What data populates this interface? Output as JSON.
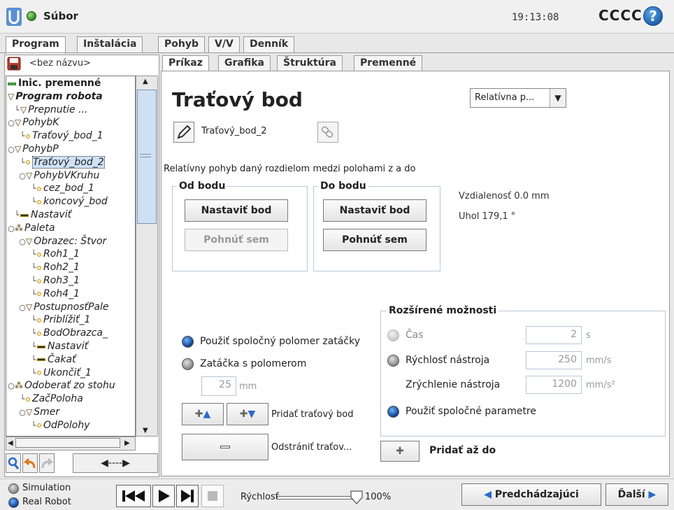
{
  "top": {
    "file_menu": "Súbor",
    "clock": "19:13:08",
    "robot_name": "CCCC",
    "help": "?"
  },
  "main_tabs": [
    "Program",
    "Inštalácia",
    "Pohyb",
    "V/V",
    "Denník"
  ],
  "program_name": "<bez názvu>",
  "tree": [
    {
      "label": "Inic. premenné",
      "type": "bar-green",
      "indent": 0,
      "bold": true,
      "italic": false
    },
    {
      "label": "Program robota",
      "type": "tri",
      "indent": 0,
      "bold": true
    },
    {
      "label": "Prepnutie ...",
      "type": "tri",
      "indent": 1
    },
    {
      "label": "PohybK",
      "type": "tri",
      "indent": 0,
      "expander": true
    },
    {
      "label": "Traťový_bod_1",
      "type": "dot",
      "indent": 2
    },
    {
      "label": "PohybP",
      "type": "tri",
      "indent": 0,
      "expander": true
    },
    {
      "label": "Traťový_bod_2",
      "type": "dot",
      "indent": 2,
      "selected": true
    },
    {
      "label": "PohybVKruhu",
      "type": "tri",
      "indent": 2,
      "expander": true
    },
    {
      "label": "cez_bod_1",
      "type": "dot",
      "indent": 4
    },
    {
      "label": "koncový_bod",
      "type": "dot",
      "indent": 4
    },
    {
      "label": "Nastaviť",
      "type": "bar",
      "indent": 1
    },
    {
      "label": "Paleta",
      "type": "pal",
      "indent": 0,
      "expander": true
    },
    {
      "label": "Obrazec: Štvor",
      "type": "tri",
      "indent": 2,
      "expander": true
    },
    {
      "label": "Roh1_1",
      "type": "dot",
      "indent": 4
    },
    {
      "label": "Roh2_1",
      "type": "dot",
      "indent": 4
    },
    {
      "label": "Roh3_1",
      "type": "dot",
      "indent": 4
    },
    {
      "label": "Roh4_1",
      "type": "dot",
      "indent": 4
    },
    {
      "label": "PostupnosťPale",
      "type": "tri",
      "indent": 2,
      "expander": true
    },
    {
      "label": "Priblížiť_1",
      "type": "dot",
      "indent": 4
    },
    {
      "label": "BodObrazca_",
      "type": "dot",
      "indent": 4
    },
    {
      "label": "Nastaviť",
      "type": "bar",
      "indent": 4
    },
    {
      "label": "Čakať",
      "type": "bar",
      "indent": 4
    },
    {
      "label": "Ukončiť_1",
      "type": "dot",
      "indent": 4
    },
    {
      "label": "Odoberať zo stohu",
      "type": "pal",
      "indent": 0,
      "expander": true
    },
    {
      "label": "ZačPoloha",
      "type": "dot",
      "indent": 2
    },
    {
      "label": "Smer",
      "type": "tri",
      "indent": 2,
      "expander": true
    },
    {
      "label": "OdPolohy",
      "type": "dot",
      "indent": 4
    }
  ],
  "sub_tabs": [
    "Príkaz",
    "Grafika",
    "Štruktúra",
    "Premenné"
  ],
  "command": {
    "title": "Traťový bod",
    "mode_dropdown": "Relatívna p...",
    "waypoint_name": "Traťový_bod_2",
    "description": "Relatívny pohyb daný rozdielom medzi polohami z a do",
    "from_group": {
      "legend": "Od bodu",
      "set_button": "Nastaviť bod",
      "move_button": "Pohnúť sem"
    },
    "to_group": {
      "legend": "Do bodu",
      "set_button": "Nastaviť bod",
      "move_button": "Pohnúť sem"
    },
    "distance": "Vzdialenosť 0.0 mm",
    "angle": "Uhol 179,1 °",
    "blend_shared": "Použiť spoločný polomer zatáčky",
    "blend_radius": "Zatáčka s polomerom",
    "blend_value": "25",
    "blend_unit": "mm",
    "add_waypoint": "Pridať traťový bod",
    "remove_waypoint": "Odstrániť traťov...",
    "advanced": {
      "legend": "Rozšírené možnosti",
      "time_label": "Čas",
      "time_value": "2",
      "time_unit": "s",
      "tool_speed_label": "Rýchlosť nástroja",
      "tool_speed_value": "250",
      "tool_speed_unit": "mm/s",
      "tool_accel_label": "Zrýchlenie nástroja",
      "tool_accel_value": "1200",
      "tool_accel_unit": "mm/s²",
      "shared_params": "Použiť spoločné parametre"
    },
    "add_until": "Pridať až do"
  },
  "bottom": {
    "simulation": "Simulation",
    "real_robot": "Real Robot",
    "speed_label": "Rýchlosť",
    "speed_value": "100%",
    "speed_fraction": 1.0,
    "prev": "Predchádzajúci",
    "next": "Ďalší"
  }
}
